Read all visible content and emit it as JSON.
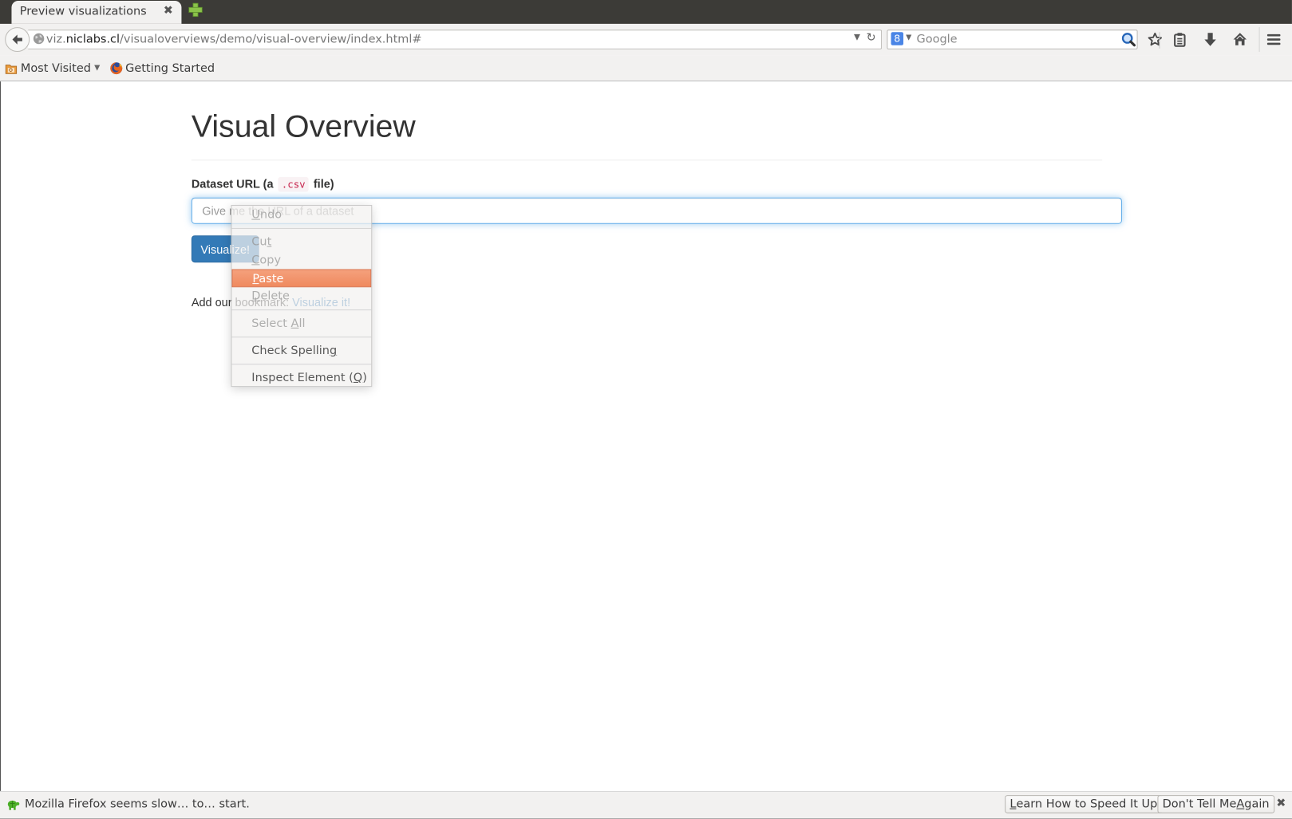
{
  "browser": {
    "tab": {
      "title": "Preview visualizations",
      "close_glyph": "✖"
    },
    "address_bar": {
      "host_prefix": "viz.",
      "host_domain": "niclabs.cl",
      "path": "/visualoverviews/demo/visual-overview/index.html#"
    },
    "search_bar": {
      "engine_glyph": "8",
      "placeholder": "Google"
    },
    "bookmarks": [
      {
        "label": "Most Visited",
        "icon": "folder-icon",
        "has_dropdown": true
      },
      {
        "label": "Getting Started",
        "icon": "firefox-icon"
      }
    ],
    "toolbar_icons": [
      "bookmark-star-icon",
      "reading-list-icon",
      "downloads-icon",
      "home-icon",
      "menu-icon"
    ]
  },
  "page": {
    "title": "Visual Overview",
    "field_label_prefix": "Dataset URL (a",
    "field_label_code": ".csv",
    "field_label_suffix": "file)",
    "input_placeholder": "Give me the URL of a dataset",
    "input_value": "",
    "submit_label": "Visualize!",
    "bookmark_prefix": "Add our bookmark:",
    "bookmark_link": "Visualize it!"
  },
  "context_menu": {
    "items": [
      {
        "label": "Undo",
        "access_key_index": 0,
        "enabled": false
      },
      {
        "label": "Cut",
        "access_key_index": 2,
        "enabled": false
      },
      {
        "label": "Copy",
        "access_key_index": 0,
        "enabled": false
      },
      {
        "label": "Paste",
        "access_key_index": 0,
        "enabled": true,
        "highlighted": true
      },
      {
        "label": "Delete",
        "access_key_index": 0,
        "enabled": false
      },
      {
        "label": "Select All",
        "access_key_index": 7,
        "enabled": false
      },
      {
        "label": "Check Spelling",
        "access_key_index": 13,
        "enabled": true
      },
      {
        "label": "Inspect Element (Q)",
        "access_key_index": 17,
        "enabled": true
      }
    ]
  },
  "notification": {
    "text": "Mozilla Firefox seems slow… to… start.",
    "buttons": [
      {
        "label": "Learn How to Speed It Up",
        "access_key_index": 0
      },
      {
        "label": "Don't Tell Me Again",
        "access_key_index": 12
      }
    ],
    "close_glyph": "✖"
  },
  "colors": {
    "primary_button": "#337ab7",
    "menu_highlight": "#f0845a",
    "code_text": "#c7254e",
    "input_focus": "#66afe9"
  }
}
